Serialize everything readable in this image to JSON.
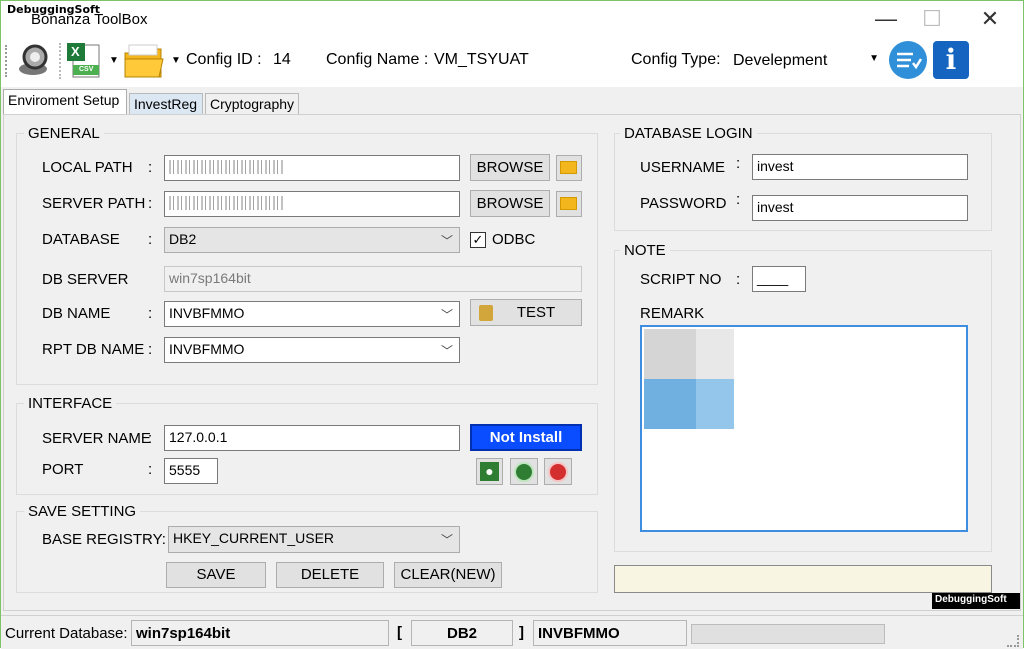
{
  "window": {
    "watermark": "DebuggingSoft",
    "title": "Bonanza ToolBox",
    "minimize_glyph": "—",
    "maximize_glyph": "☐",
    "close_glyph": "✕"
  },
  "toolbar": {
    "config_id_label": "Config ID :",
    "config_id_value": "14",
    "config_name_label": "Config Name :",
    "config_name_value": "VM_TSYUAT",
    "config_type_label": "Config Type:",
    "config_type_value": "Develepment",
    "excel_caption": "X",
    "csv_caption": "CSV",
    "info_glyph": "i"
  },
  "tabs": [
    {
      "label": "Enviroment Setup"
    },
    {
      "label": "InvestReg"
    },
    {
      "label": "Cryptography"
    }
  ],
  "general": {
    "title": "GENERAL",
    "local_path_label": "LOCAL PATH",
    "server_path_label": "SERVER PATH",
    "database_label": "DATABASE",
    "database_value": "DB2",
    "odbc_label": "ODBC",
    "db_server_label": "DB SERVER",
    "db_server_value": "win7sp164bit",
    "db_name_label": "DB NAME",
    "db_name_value": "INVBFMMO",
    "rpt_db_name_label": "RPT DB NAME",
    "rpt_db_name_value": "INVBFMMO",
    "browse_label": "BROWSE",
    "test_label": "TEST",
    "colon": ":"
  },
  "interface": {
    "title": "INTERFACE",
    "server_name_label": "SERVER NAME",
    "server_name_value": "127.0.0.1",
    "port_label": "PORT",
    "port_value": "5555",
    "status_button": "Not Install"
  },
  "save_setting": {
    "title": "SAVE SETTING",
    "base_registry_label": "BASE REGISTRY:",
    "base_registry_value": "HKEY_CURRENT_USER",
    "save_label": "SAVE",
    "delete_label": "DELETE",
    "clear_label": "CLEAR(NEW)"
  },
  "database_login": {
    "title": "DATABASE LOGIN",
    "username_label": "USERNAME",
    "username_value": "invest",
    "password_label": "PASSWORD",
    "password_value": "invest"
  },
  "note": {
    "title": "NOTE",
    "script_no_label": "SCRIPT NO",
    "script_no_value": "____",
    "remark_label": "REMARK"
  },
  "status_bar": {
    "current_db_label": "Current Database:",
    "current_db_value": "win7sp164bit",
    "open_bracket": "[",
    "db_type": "DB2",
    "close_bracket": "]",
    "db_name": "INVBFMMO"
  },
  "footer_watermark": "DebuggingSoft",
  "colors": {
    "accent_blue": "#0a4cff",
    "toolbar_circle": "#2f8fd8",
    "info_square": "#1565c0",
    "status_green": "#2e7d32",
    "status_red": "#d32f2f"
  }
}
